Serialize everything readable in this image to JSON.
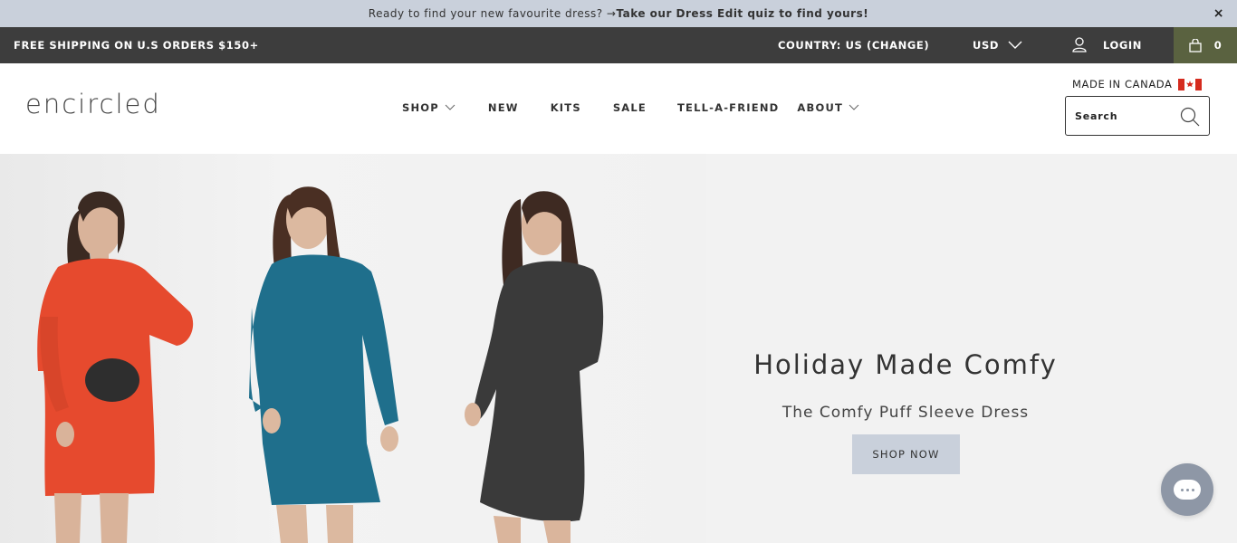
{
  "announcement": {
    "text": "Ready to find your new favourite dress? → ",
    "link": "Take our Dress Edit quiz to find yours!",
    "close_icon": "×"
  },
  "utility": {
    "shipping": "FREE SHIPPING ON U.S ORDERS $150+",
    "country": "COUNTRY: US (CHANGE)",
    "currency": "USD",
    "login": "LOGIN",
    "cart_count": "0",
    "cart_bg": "#5a6240"
  },
  "header": {
    "logo": "encircled",
    "nav": [
      {
        "label": "SHOP",
        "has_dropdown": true
      },
      {
        "label": "NEW",
        "has_dropdown": false
      },
      {
        "label": "KITS",
        "has_dropdown": false
      },
      {
        "label": "SALE",
        "has_dropdown": false
      },
      {
        "label": "TELL-A-FRIEND",
        "has_dropdown": false
      },
      {
        "label": "ABOUT",
        "has_dropdown": true
      }
    ],
    "made_in": "MADE IN CANADA",
    "search_placeholder": "Search"
  },
  "hero": {
    "title": "Holiday Made Comfy",
    "subtitle": "The Comfy Puff Sleeve Dress",
    "cta": "SHOP NOW",
    "dress_colors": [
      "#e64a2e",
      "#1f6f8c",
      "#3a3a3a"
    ]
  },
  "colors": {
    "announce_bg": "#c9d0db",
    "utility_bg": "#3d3d3d",
    "chat_bg": "#8e97a6"
  }
}
